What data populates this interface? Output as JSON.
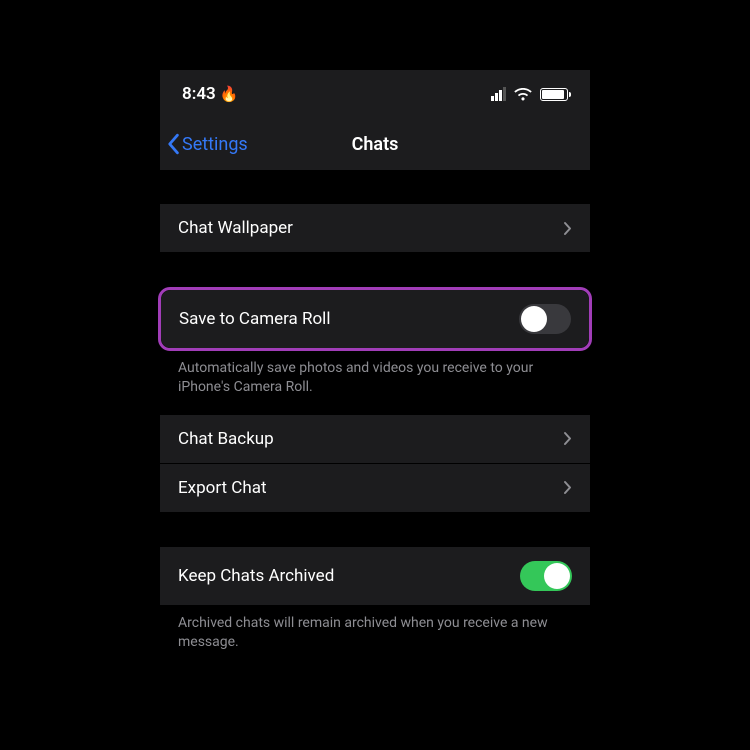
{
  "status": {
    "time": "8:43"
  },
  "nav": {
    "back_label": "Settings",
    "title": "Chats"
  },
  "rows": {
    "wallpaper": "Chat Wallpaper",
    "save_camera": "Save to Camera Roll",
    "save_camera_footer": "Automatically save photos and videos you receive to your iPhone's Camera Roll.",
    "backup": "Chat Backup",
    "export": "Export Chat",
    "archived": "Keep Chats Archived",
    "archived_footer": "Archived chats will remain archived when you receive a new message."
  },
  "toggles": {
    "save_camera": false,
    "archived": true
  }
}
